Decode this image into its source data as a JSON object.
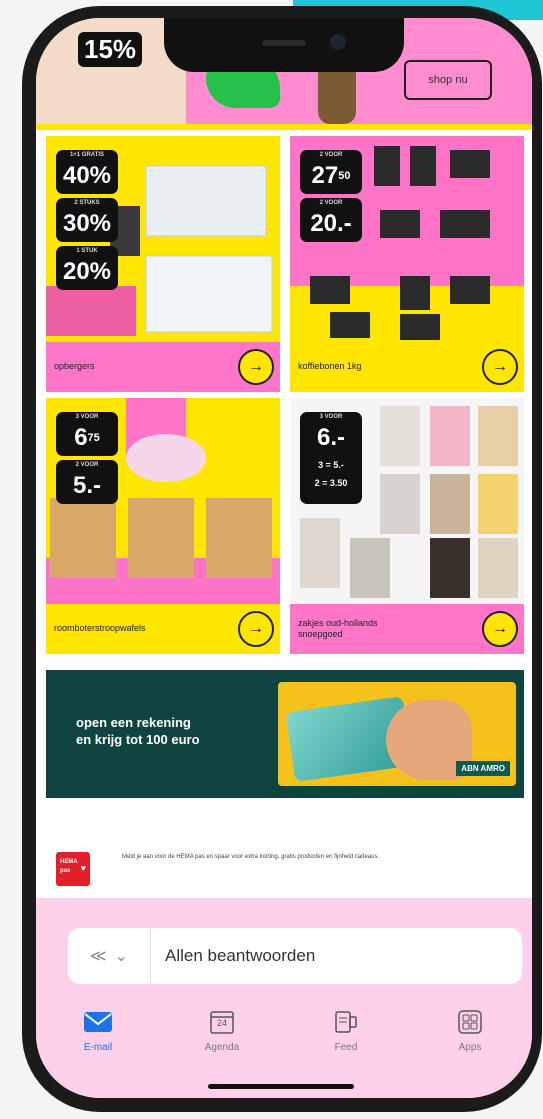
{
  "promo_top": {
    "discount": "15%",
    "button_label": "shop nu"
  },
  "tiles": [
    {
      "label": "opbergers",
      "prices": [
        {
          "caption": "1+1 GRATIS",
          "value": "40%"
        },
        {
          "caption": "2 STUKS",
          "value": "30%"
        },
        {
          "caption": "1 STUK",
          "value": "20%"
        }
      ]
    },
    {
      "label": "koffiebonen 1kg",
      "prices": [
        {
          "caption": "2 VOOR",
          "value": "27",
          "cents": "50"
        },
        {
          "caption": "2 VOOR",
          "value": "20.-"
        }
      ]
    },
    {
      "label": "roomboterstroopwafels",
      "prices": [
        {
          "caption": "3 VOOR",
          "value": "6",
          "cents": "75"
        },
        {
          "caption": "2 VOOR",
          "value": "5.-"
        }
      ]
    },
    {
      "label": "zakjes oud-hollands\nsnoepgoed",
      "prices": [
        {
          "caption": "3 VOOR",
          "value": "6.-"
        },
        {
          "caption": "",
          "value": "3 = 5.-"
        },
        {
          "caption": "",
          "value": "2 = 3.50"
        }
      ]
    }
  ],
  "bank_ad": {
    "headline": "open een rekening\nen krijg tot 100 euro",
    "brand": "ABN AMRO"
  },
  "hema": {
    "logo_line1": "HEMA",
    "logo_line2": "pas",
    "text": "Meld je aan voor de HEMA pas en spaar voor extra korting, gratis producten en fijnheid cadeaus."
  },
  "reply_bar": {
    "label": "Allen beantwoorden"
  },
  "tabs": [
    {
      "label": "E-mail",
      "icon": "mail-icon",
      "active": true
    },
    {
      "label": "Agenda",
      "icon": "calendar-icon",
      "day": "24"
    },
    {
      "label": "Feed",
      "icon": "feed-icon"
    },
    {
      "label": "Apps",
      "icon": "apps-icon"
    }
  ],
  "colors": {
    "yellow": "#ffe600",
    "pink": "#ff74c6",
    "bank_green": "#0f4440",
    "active_tab": "#1a73e8"
  }
}
